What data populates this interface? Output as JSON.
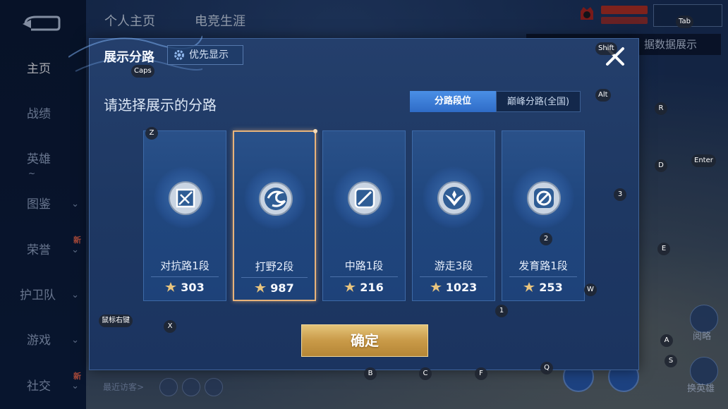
{
  "sidebar": {
    "items": [
      {
        "label": "主页"
      },
      {
        "label": "战绩"
      },
      {
        "label": "英雄",
        "note": "~"
      },
      {
        "label": "图鉴"
      },
      {
        "label": "荣誉",
        "badge": "新"
      },
      {
        "label": "护卫队"
      },
      {
        "label": "游戏"
      },
      {
        "label": "社交",
        "badge": "新"
      }
    ]
  },
  "header": {
    "tabs": [
      "个人主页",
      "电竞生涯"
    ],
    "tooltip_text": "据数据展示"
  },
  "footer": {
    "recent_visitors_label": "最近访客>"
  },
  "side_buttons": [
    {
      "label": "阅略"
    },
    {
      "label": "换英雄"
    }
  ],
  "modal": {
    "title": "展示分路",
    "priority_button": "优先显示",
    "heading": "请选择展示的分路",
    "segments": [
      "分路段位",
      "巅峰分路(全国)"
    ],
    "lanes": [
      {
        "rank": "对抗路1段",
        "score": "303",
        "icon": "shield-cross-icon"
      },
      {
        "rank": "打野2段",
        "score": "987",
        "icon": "dragon-swirl-icon"
      },
      {
        "rank": "中路1段",
        "score": "216",
        "icon": "slash-square-icon"
      },
      {
        "rank": "游走3段",
        "score": "1023",
        "icon": "wings-icon"
      },
      {
        "rank": "发育路1段",
        "score": "253",
        "icon": "ring-arrow-icon"
      }
    ],
    "confirm_label": "确定"
  },
  "key_hints": {
    "caps": "Caps",
    "shift": "Shift",
    "tab": "Tab",
    "alt": "Alt",
    "r": "R",
    "d": "D",
    "enter": "Enter",
    "three": "3",
    "two": "2",
    "e": "E",
    "w": "W",
    "one": "1",
    "z": "Z",
    "x": "X",
    "mouse_right": "鼠标右键",
    "a": "A",
    "s": "S",
    "b": "B",
    "c": "C",
    "f": "F",
    "q": "Q"
  },
  "colors": {
    "modal_bg": "#1e3863",
    "accent_blue": "#2f6cc7",
    "selected_border": "#e8b37a",
    "confirm_gold": "#c99a48"
  }
}
